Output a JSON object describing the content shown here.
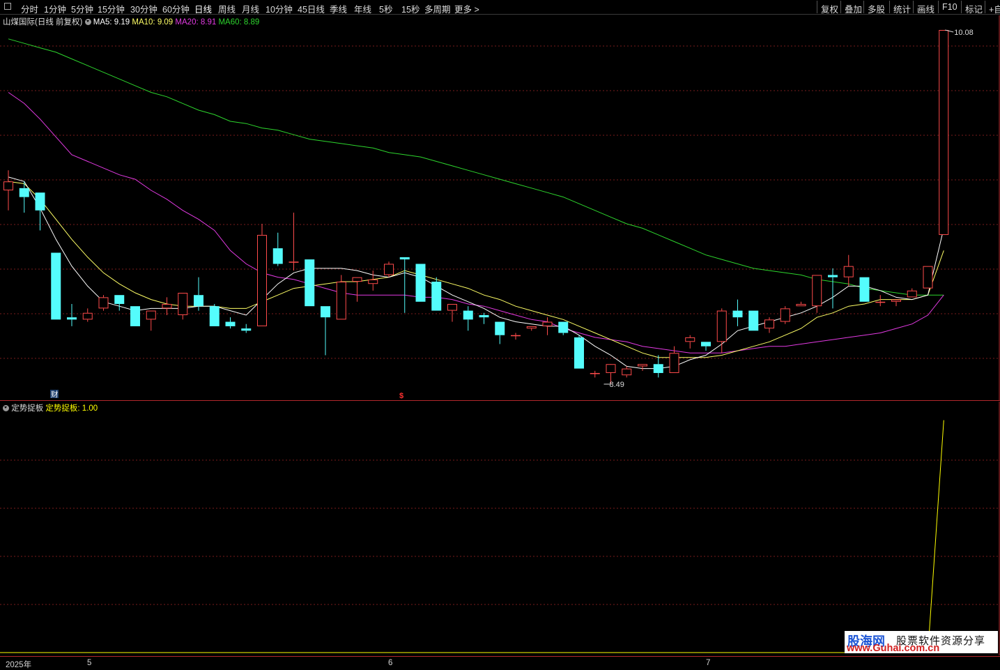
{
  "toolbar": {
    "periods": [
      "分时",
      "1分钟",
      "5分钟",
      "15分钟",
      "30分钟",
      "60分钟",
      "日线",
      "周线",
      "月线",
      "10分钟",
      "45日线",
      "季线",
      "年线",
      "5秒",
      "15秒",
      "多周期",
      "更多 >"
    ],
    "active_period": "日线",
    "tools": [
      "复权",
      "叠加",
      "多股",
      "统计",
      "画线",
      "F10",
      "标记",
      "+自"
    ]
  },
  "main_legend": {
    "title": "山煤国际(日线 前复权)",
    "ma5": "MA5: 9.19",
    "ma10": "MA10: 9.09",
    "ma20": "MA20: 8.91",
    "ma60": "MA60: 8.89"
  },
  "sub_legend": {
    "title": "定势捉板",
    "indicator": "定势捉板: 1.00"
  },
  "markers": {
    "high": "10.08",
    "low": "8.49",
    "finance": "财",
    "dollar": "$"
  },
  "x_axis": [
    "2025年",
    "5",
    "6",
    "7"
  ],
  "colors": {
    "up": "#ff4b4b",
    "down": "#54fcfc",
    "ma5": "#ffffff",
    "ma10": "#ffff66",
    "ma20": "#e33ae3",
    "ma60": "#2dd52d",
    "grid": "#7a1d1d",
    "border": "#b2272b",
    "indicator": "#ffff00"
  },
  "chart_data": {
    "type": "candlestick",
    "price_range": [
      8.4,
      10.12
    ],
    "candles": [
      {
        "o": 9.36,
        "h": 9.45,
        "l": 9.27,
        "c": 9.4
      },
      {
        "o": 9.37,
        "h": 9.4,
        "l": 9.26,
        "c": 9.33
      },
      {
        "o": 9.35,
        "h": 9.35,
        "l": 9.18,
        "c": 9.27
      },
      {
        "o": 9.08,
        "h": 9.08,
        "l": 8.78,
        "c": 8.78
      },
      {
        "o": 8.79,
        "h": 8.85,
        "l": 8.75,
        "c": 8.78
      },
      {
        "o": 8.78,
        "h": 8.83,
        "l": 8.77,
        "c": 8.81
      },
      {
        "o": 8.83,
        "h": 8.89,
        "l": 8.82,
        "c": 8.88
      },
      {
        "o": 8.89,
        "h": 8.89,
        "l": 8.82,
        "c": 8.85
      },
      {
        "o": 8.84,
        "h": 8.84,
        "l": 8.75,
        "c": 8.75
      },
      {
        "o": 8.78,
        "h": 8.82,
        "l": 8.73,
        "c": 8.82
      },
      {
        "o": 8.83,
        "h": 8.88,
        "l": 8.8,
        "c": 8.85
      },
      {
        "o": 8.8,
        "h": 8.89,
        "l": 8.78,
        "c": 8.9
      },
      {
        "o": 8.89,
        "h": 8.97,
        "l": 8.82,
        "c": 8.84
      },
      {
        "o": 8.84,
        "h": 8.85,
        "l": 8.75,
        "c": 8.75
      },
      {
        "o": 8.77,
        "h": 8.79,
        "l": 8.74,
        "c": 8.75
      },
      {
        "o": 8.74,
        "h": 8.76,
        "l": 8.72,
        "c": 8.73
      },
      {
        "o": 8.75,
        "h": 9.21,
        "l": 8.75,
        "c": 9.16
      },
      {
        "o": 9.1,
        "h": 9.17,
        "l": 9.02,
        "c": 9.03
      },
      {
        "o": 9.04,
        "h": 9.26,
        "l": 9.0,
        "c": 9.04
      },
      {
        "o": 9.05,
        "h": 9.05,
        "l": 8.84,
        "c": 8.84
      },
      {
        "o": 8.84,
        "h": 8.84,
        "l": 8.62,
        "c": 8.79
      },
      {
        "o": 8.78,
        "h": 8.98,
        "l": 8.78,
        "c": 8.95
      },
      {
        "o": 8.95,
        "h": 8.97,
        "l": 8.86,
        "c": 8.97
      },
      {
        "o": 8.94,
        "h": 9.0,
        "l": 8.91,
        "c": 8.96
      },
      {
        "o": 8.98,
        "h": 9.04,
        "l": 8.97,
        "c": 9.03
      },
      {
        "o": 9.06,
        "h": 9.06,
        "l": 8.81,
        "c": 9.05
      },
      {
        "o": 9.03,
        "h": 9.03,
        "l": 8.86,
        "c": 8.86
      },
      {
        "o": 8.95,
        "h": 8.97,
        "l": 8.82,
        "c": 8.82
      },
      {
        "o": 8.82,
        "h": 8.85,
        "l": 8.77,
        "c": 8.85
      },
      {
        "o": 8.82,
        "h": 8.84,
        "l": 8.73,
        "c": 8.78
      },
      {
        "o": 8.8,
        "h": 8.81,
        "l": 8.76,
        "c": 8.79
      },
      {
        "o": 8.77,
        "h": 8.77,
        "l": 8.67,
        "c": 8.71
      },
      {
        "o": 8.71,
        "h": 8.72,
        "l": 8.69,
        "c": 8.71
      },
      {
        "o": 8.74,
        "h": 8.75,
        "l": 8.73,
        "c": 8.75
      },
      {
        "o": 8.75,
        "h": 8.79,
        "l": 8.71,
        "c": 8.77
      },
      {
        "o": 8.77,
        "h": 8.77,
        "l": 8.71,
        "c": 8.72
      },
      {
        "o": 8.7,
        "h": 8.71,
        "l": 8.56,
        "c": 8.56
      },
      {
        "o": 8.54,
        "h": 8.55,
        "l": 8.52,
        "c": 8.54
      },
      {
        "o": 8.54,
        "h": 8.54,
        "l": 8.49,
        "c": 8.58
      },
      {
        "o": 8.53,
        "h": 8.57,
        "l": 8.52,
        "c": 8.56
      },
      {
        "o": 8.57,
        "h": 8.58,
        "l": 8.55,
        "c": 8.58
      },
      {
        "o": 8.58,
        "h": 8.62,
        "l": 8.52,
        "c": 8.54
      },
      {
        "o": 8.54,
        "h": 8.66,
        "l": 8.54,
        "c": 8.63
      },
      {
        "o": 8.68,
        "h": 8.71,
        "l": 8.65,
        "c": 8.7
      },
      {
        "o": 8.68,
        "h": 8.68,
        "l": 8.64,
        "c": 8.66
      },
      {
        "o": 8.68,
        "h": 8.83,
        "l": 8.63,
        "c": 8.82
      },
      {
        "o": 8.82,
        "h": 8.87,
        "l": 8.75,
        "c": 8.79
      },
      {
        "o": 8.82,
        "h": 8.82,
        "l": 8.73,
        "c": 8.73
      },
      {
        "o": 8.74,
        "h": 8.79,
        "l": 8.72,
        "c": 8.78
      },
      {
        "o": 8.77,
        "h": 8.84,
        "l": 8.76,
        "c": 8.83
      },
      {
        "o": 8.84,
        "h": 8.86,
        "l": 8.84,
        "c": 8.85
      },
      {
        "o": 8.84,
        "h": 8.98,
        "l": 8.81,
        "c": 8.98
      },
      {
        "o": 8.98,
        "h": 9.01,
        "l": 8.83,
        "c": 8.97
      },
      {
        "o": 8.97,
        "h": 9.07,
        "l": 8.93,
        "c": 9.02
      },
      {
        "o": 8.97,
        "h": 8.97,
        "l": 8.86,
        "c": 8.86
      },
      {
        "o": 8.86,
        "h": 8.89,
        "l": 8.84,
        "c": 8.86
      },
      {
        "o": 8.86,
        "h": 8.86,
        "l": 8.84,
        "c": 8.87
      },
      {
        "o": 8.88,
        "h": 8.92,
        "l": 8.88,
        "c": 8.91
      },
      {
        "o": 8.92,
        "h": 9.02,
        "l": 8.92,
        "c": 9.02
      },
      {
        "o": 9.16,
        "h": 10.08,
        "l": 9.16,
        "c": 10.08
      }
    ],
    "ma5": [
      9.42,
      9.4,
      9.28,
      9.14,
      9.02,
      8.93,
      8.86,
      8.84,
      8.82,
      8.83,
      8.83,
      8.83,
      8.84,
      8.84,
      8.82,
      8.8,
      8.87,
      8.94,
      8.99,
      9.01,
      9.01,
      9.01,
      9.0,
      8.98,
      8.97,
      8.99,
      8.97,
      8.93,
      8.89,
      8.86,
      8.83,
      8.79,
      8.77,
      8.76,
      8.75,
      8.75,
      8.71,
      8.66,
      8.62,
      8.57,
      8.56,
      8.56,
      8.57,
      8.6,
      8.62,
      8.67,
      8.73,
      8.75,
      8.77,
      8.79,
      8.81,
      8.84,
      8.88,
      8.93,
      8.93,
      8.91,
      8.88,
      8.87,
      8.89,
      9.19
    ],
    "ma10": [
      9.4,
      9.39,
      9.32,
      9.23,
      9.14,
      9.06,
      8.99,
      8.94,
      8.9,
      8.87,
      8.85,
      8.84,
      8.84,
      8.84,
      8.83,
      8.83,
      8.86,
      8.89,
      8.92,
      8.93,
      8.94,
      8.95,
      8.95,
      8.96,
      8.97,
      9.0,
      8.98,
      8.96,
      8.94,
      8.92,
      8.89,
      8.87,
      8.84,
      8.82,
      8.8,
      8.78,
      8.75,
      8.72,
      8.69,
      8.66,
      8.63,
      8.61,
      8.61,
      8.61,
      8.61,
      8.62,
      8.64,
      8.66,
      8.68,
      8.71,
      8.74,
      8.79,
      8.81,
      8.84,
      8.85,
      8.87,
      8.87,
      8.87,
      8.89,
      9.09
    ],
    "ma20": [
      9.8,
      9.75,
      9.68,
      9.6,
      9.52,
      9.49,
      9.46,
      9.43,
      9.41,
      9.36,
      9.32,
      9.27,
      9.23,
      9.18,
      9.09,
      9.03,
      8.99,
      8.97,
      8.96,
      8.94,
      8.92,
      8.9,
      8.89,
      8.89,
      8.89,
      8.89,
      8.88,
      8.88,
      8.87,
      8.85,
      8.84,
      8.82,
      8.8,
      8.78,
      8.77,
      8.74,
      8.72,
      8.7,
      8.69,
      8.68,
      8.66,
      8.65,
      8.64,
      8.63,
      8.63,
      8.63,
      8.64,
      8.65,
      8.66,
      8.66,
      8.67,
      8.68,
      8.69,
      8.7,
      8.71,
      8.72,
      8.74,
      8.76,
      8.8,
      8.89
    ],
    "ma60": [
      10.04,
      10.02,
      10.0,
      9.98,
      9.95,
      9.92,
      9.89,
      9.86,
      9.83,
      9.8,
      9.78,
      9.75,
      9.72,
      9.7,
      9.67,
      9.66,
      9.64,
      9.63,
      9.61,
      9.59,
      9.58,
      9.57,
      9.56,
      9.55,
      9.53,
      9.52,
      9.51,
      9.49,
      9.47,
      9.45,
      9.43,
      9.41,
      9.39,
      9.37,
      9.35,
      9.33,
      9.3,
      9.27,
      9.24,
      9.21,
      9.19,
      9.16,
      9.13,
      9.1,
      9.07,
      9.05,
      9.03,
      9.01,
      9.0,
      8.99,
      8.98,
      8.96,
      8.95,
      8.94,
      8.92,
      8.91,
      8.9,
      8.89,
      8.89,
      8.89
    ],
    "indicator": {
      "name": "定势捉板",
      "range": [
        0,
        1.02
      ],
      "values_before_last": 0,
      "last": 1.0
    }
  }
}
